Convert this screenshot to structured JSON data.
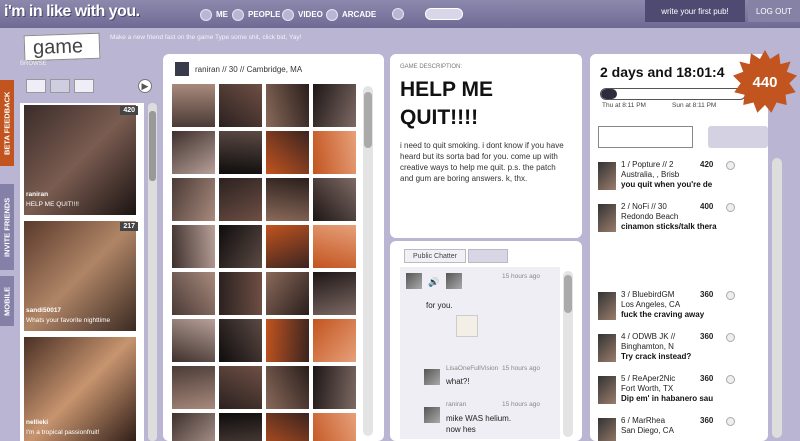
{
  "topbar": {
    "logo": "i'm in like with you.",
    "nav": [
      "ME",
      "PEOPLE",
      "VIDEO",
      "ARCADE"
    ],
    "write_pub": "write your first pub!",
    "logout": "LOG OUT"
  },
  "section_tab": "game",
  "subtitle": "Make a new friend fast on the game Type some shit, click bid, Yay!",
  "side_tabs": [
    "BETA FEEDBACK",
    "INVITE FRIENDS",
    "MOBILE"
  ],
  "browse": {
    "label": "BROWSE",
    "cards": [
      {
        "count": "420",
        "name": "raniran",
        "title": "HELP ME QUIT!!!!"
      },
      {
        "count": "217",
        "name": "sandi50017",
        "title": "Whats your favorite nighttime"
      },
      {
        "count": "",
        "name": "nellieki",
        "title": "I'm a tropical passionfruit!"
      }
    ]
  },
  "grid": {
    "header": "raniran // 30 // Cambridge, MA"
  },
  "description": {
    "label": "GAME DESCRIPTION:",
    "title": "HELP ME QUIT!!!!",
    "text": "i need to quit smoking. i dont know if you have heard but its sorta bad for you. come up with creative ways to help me quit. p.s. the patch and gum are boring answers. k, thx."
  },
  "chatter": {
    "tab": "Public Chatter",
    "messages": [
      {
        "time": "15 hours ago",
        "text": "for you."
      },
      {
        "name": "LisaOneFullVision",
        "time": "15 hours ago",
        "text": "what?!"
      },
      {
        "name": "raniran",
        "time": "15 hours ago",
        "text": "mike WAS helium.  now hes"
      }
    ]
  },
  "timer": {
    "countdown": "2 days and 18:01:4",
    "progress": 0.03,
    "start": "Thu at 8:11 PM",
    "end": "Sun at 8:11 PM",
    "score": "440"
  },
  "ranking": [
    {
      "line1": "1 / Popture // 2",
      "line2": "Australia, , Brisb",
      "line3": "you quit when you're de",
      "score": "420"
    },
    {
      "line1": "2 / NoFi // 30",
      "line2": "Redondo Beach",
      "line3": "cinamon sticks/talk thera",
      "score": "400"
    },
    {
      "line1": "3 / BluebirdGM",
      "line2": "Los Angeles, CA",
      "line3": "fuck the craving away",
      "score": "360"
    },
    {
      "line1": "4 / ODWB JK //",
      "line2": "Binghamton, N",
      "line3": "Try crack instead?",
      "score": "360"
    },
    {
      "line1": "5 / ReAper2Nic",
      "line2": "Fort Worth, TX",
      "line3": "Dip em' in habanero sau",
      "score": "360"
    },
    {
      "line1": "6 / MarRhea",
      "line2": "San Diego, CA",
      "line3": "",
      "score": "360"
    }
  ],
  "colors": {
    "accent": "#c2541f",
    "nav": "#7a76a0",
    "bg": "#b9b5d2"
  }
}
